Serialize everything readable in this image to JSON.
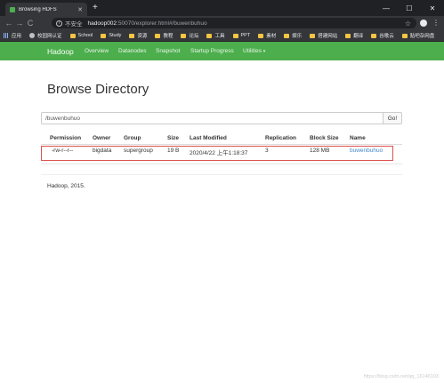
{
  "browser": {
    "tab_title": "Browsing HDFS",
    "new_tab": "+",
    "win": {
      "minimize": "—",
      "maximize": "☐",
      "close": "✕"
    },
    "nav": {
      "back": "←",
      "forward": "→",
      "reload": "C"
    },
    "insecure_label": "不安全",
    "url_host": "hadoop002",
    "url_rest": ":50070/explorer.html#/buwenbuhuo",
    "bookmarks": [
      "应用",
      "校园网认证",
      "School",
      "Study",
      "资源",
      "教程",
      "论坛",
      "工具",
      "PPT",
      "素材",
      "娱乐",
      "搭建网站",
      "翻译",
      "谷歌云",
      "贴吧杂网盘"
    ]
  },
  "navbar": {
    "brand": "Hadoop",
    "links": [
      "Overview",
      "Datanodes",
      "Snapshot",
      "Startup Progress",
      "Utilities"
    ]
  },
  "page": {
    "title": "Browse Directory",
    "path_value": "/buwenbuhuo",
    "go_label": "Go!",
    "columns": [
      "Permission",
      "Owner",
      "Group",
      "Size",
      "Last Modified",
      "Replication",
      "Block Size",
      "Name"
    ],
    "rows": [
      [
        "-rw-r--r--",
        "bigdata",
        "supergroup",
        "19 B",
        "2020/4/22 上午1:18:37",
        "3",
        "128 MB",
        "buwenbuhuo"
      ]
    ],
    "footer": "Hadoop, 2015."
  },
  "watermark": "https://blog.csdn.net/qq_16146103"
}
